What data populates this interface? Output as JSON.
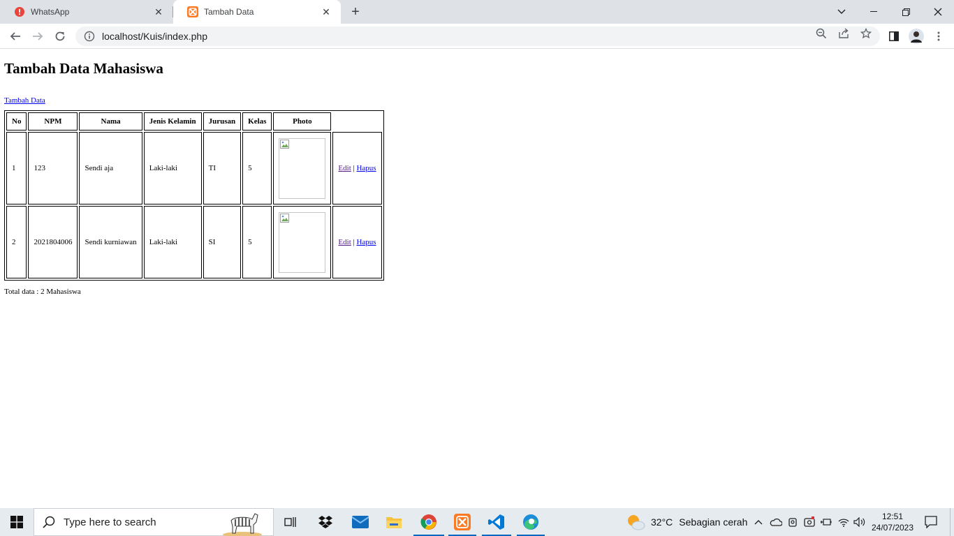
{
  "browser": {
    "tabs": [
      {
        "title": "WhatsApp",
        "active": false
      },
      {
        "title": "Tambah Data",
        "active": true
      }
    ],
    "address": "localhost/Kuis/index.php"
  },
  "page": {
    "heading": "Tambah Data Mahasiswa",
    "add_link": "Tambah Data",
    "table": {
      "headers": [
        "No",
        "NPM",
        "Nama",
        "Jenis Kelamin",
        "Jurusan",
        "Kelas",
        "Photo"
      ],
      "rows": [
        {
          "no": "1",
          "npm": "123",
          "nama": "Sendi aja",
          "jk": "Laki-laki",
          "jurusan": "TI",
          "kelas": "5"
        },
        {
          "no": "2",
          "npm": "2021804006",
          "nama": "Sendi kurniawan",
          "jk": "Laki-laki",
          "jurusan": "SI",
          "kelas": "5"
        }
      ],
      "edit_label": "Edit",
      "separator": "|",
      "delete_label": "Hapus"
    },
    "total": "Total data : 2 Mahasiswa"
  },
  "taskbar": {
    "search_placeholder": "Type here to search",
    "weather": {
      "temp": "32°C",
      "desc": "Sebagian cerah"
    },
    "time": "12:51",
    "date": "24/07/2023"
  },
  "colors": {
    "link": "#0000ee",
    "visited": "#551a8b",
    "taskbar": "#e6ebf0",
    "accent": "#0067c0"
  }
}
